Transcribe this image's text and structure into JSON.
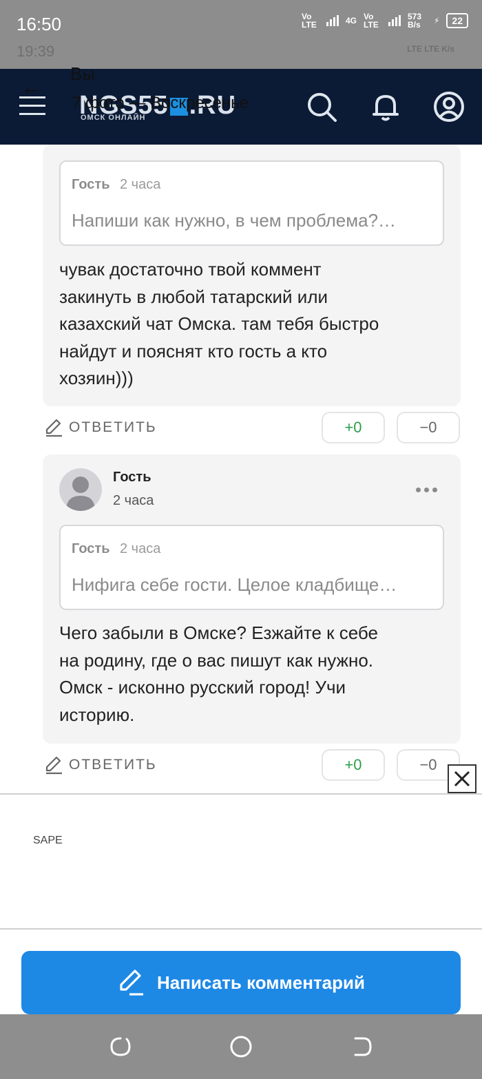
{
  "status_bar": {
    "time": "16:50",
    "net1": "Vo LTE",
    "net2": "4G",
    "net3": "Vo LTE",
    "speed": "573 B/s",
    "battery": "22",
    "ghost_time": "19:39",
    "ghost_right": "LTE LTE K/s"
  },
  "header": {
    "logo_text_left": "NGS55",
    "logo_text_right": ".RU",
    "logo_sub": "ОМСК ОНЛАЙН",
    "overlay_title": "Вы",
    "overlay_sub": "7 фото — Воскресенье",
    "icons": [
      "menu-icon",
      "search-icon",
      "bell-icon",
      "account-icon"
    ]
  },
  "comments": [
    {
      "quote_author": "Гость",
      "quote_time": "2 часа",
      "quote_text": "Напиши как нужно, в чем проблема?…",
      "lines": [
        "чувак достаточно твой коммент",
        "закинуть в любой татарский или",
        "казахский чат Омска. там тебя быстро",
        "найдут и пояснят кто гость а кто",
        "хозяин)))"
      ],
      "reply_label": "ОТВЕТИТЬ",
      "upvotes": "+0",
      "downvotes": "−0"
    },
    {
      "author": "Гость",
      "time": "2 часа",
      "quote_author": "Гость",
      "quote_time": "2 часа",
      "quote_text": "Нифига себе гости. Целое кладбище…",
      "lines": [
        "Чего забыли в Омске? Езжайте к себе",
        "на родину, где о вас пишут как нужно.",
        "Омск - исконно русский город! Учи",
        "историю."
      ],
      "reply_label": "ОТВЕТИТЬ",
      "upvotes": "+0",
      "downvotes": "−0"
    }
  ],
  "ad": {
    "label": "SAPE"
  },
  "write_button": {
    "label": "Написать комментарий"
  },
  "nav": [
    "recents-icon",
    "home-icon",
    "back-icon"
  ],
  "colors": {
    "accent": "#1e88e5",
    "header_bg": "#0b1b36",
    "upvote": "#2e9e4a"
  }
}
